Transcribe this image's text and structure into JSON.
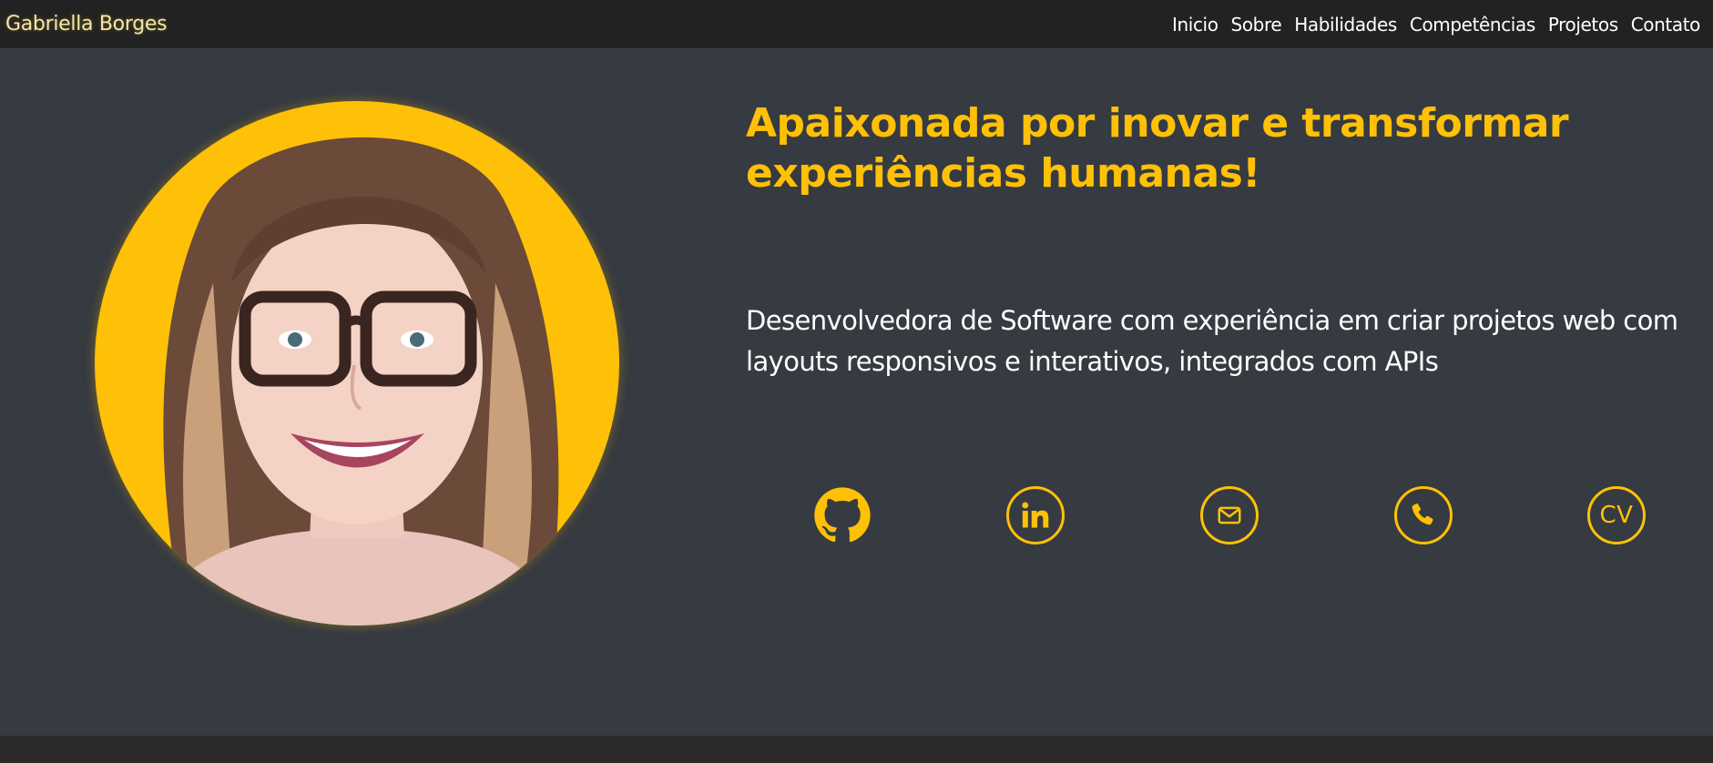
{
  "navbar": {
    "brand": "Gabriella Borges",
    "links": [
      "Inicio",
      "Sobre",
      "Habilidades",
      "Competências",
      "Projetos",
      "Contato"
    ]
  },
  "hero": {
    "headline": "Apaixonada por inovar e transformar experiências humanas!",
    "description": "Desenvolvedora de Software com experiência em criar projetos web com layouts responsivos e interativos, integrados com APIs",
    "social": {
      "icons": [
        "github-icon",
        "linkedin-icon",
        "email-icon",
        "whatsapp-icon",
        "cv-icon"
      ],
      "cv_label": "CV"
    }
  },
  "colors": {
    "accent": "#ffc107",
    "background": "#363a41",
    "navbar": "#222222",
    "text": "#ffffff"
  }
}
